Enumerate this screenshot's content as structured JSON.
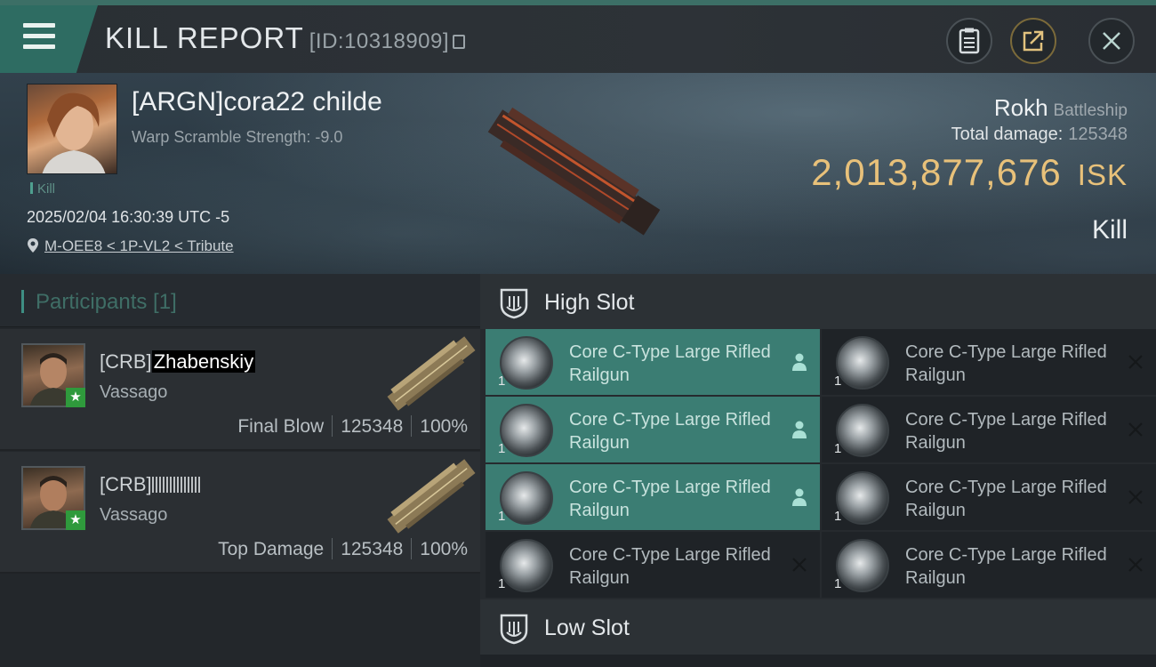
{
  "header": {
    "title": "KILL REPORT",
    "report_id": "[ID:10318909]"
  },
  "victim": {
    "name": "[ARGN]cora22 childe",
    "warp_scramble": "Warp Scramble Strength: -9.0",
    "tag": "Kill",
    "datetime": "2025/02/04 16:30:39 UTC -5",
    "location": "M-OEE8 < 1P-VL2 < Tribute",
    "ship": "Rokh",
    "ship_class": "Battleship",
    "total_damage_label": "Total damage:",
    "total_damage": "125348",
    "isk_value": "2,013,877,676",
    "isk_currency": "ISK",
    "result": "Kill"
  },
  "participants": {
    "label": "Participants [1]",
    "rows": [
      {
        "corp": "[CRB]",
        "name": "Zhabenskiy",
        "ship": "Vassago",
        "role": "Final Blow",
        "damage": "125348",
        "percent": "100%"
      },
      {
        "corp": "[CRB]",
        "name": "",
        "ship": "Vassago",
        "role": "Top Damage",
        "damage": "125348",
        "percent": "100%"
      }
    ]
  },
  "slots": {
    "high_label": "High Slot",
    "low_label": "Low Slot",
    "high_modules": [
      {
        "name": "Core C-Type Large Rifled Railgun",
        "qty": "1",
        "status": "dropped"
      },
      {
        "name": "Core C-Type Large Rifled Railgun",
        "qty": "1",
        "status": "destroyed"
      },
      {
        "name": "Core C-Type Large Rifled Railgun",
        "qty": "1",
        "status": "dropped"
      },
      {
        "name": "Core C-Type Large Rifled Railgun",
        "qty": "1",
        "status": "destroyed"
      },
      {
        "name": "Core C-Type Large Rifled Railgun",
        "qty": "1",
        "status": "dropped"
      },
      {
        "name": "Core C-Type Large Rifled Railgun",
        "qty": "1",
        "status": "destroyed"
      },
      {
        "name": "Core C-Type Large Rifled Railgun",
        "qty": "1",
        "status": "destroyed"
      },
      {
        "name": "Core C-Type Large Rifled Railgun",
        "qty": "1",
        "status": "destroyed"
      }
    ]
  },
  "colors": {
    "accent": "#3b7d73",
    "isk": "#e8c17a",
    "badge": "#2f9a3c"
  }
}
